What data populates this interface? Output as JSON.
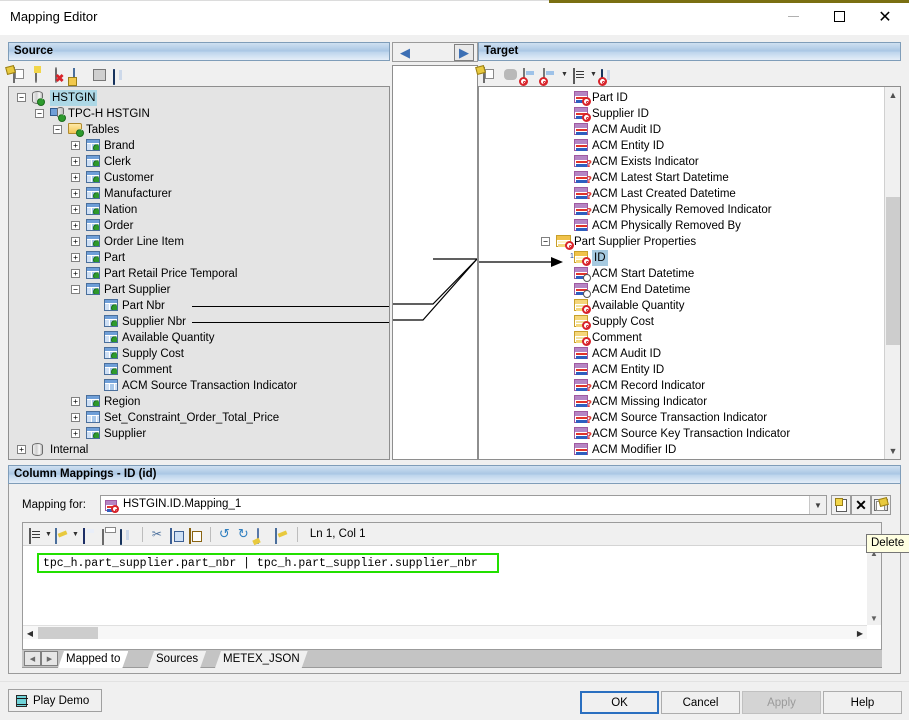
{
  "window": {
    "title": "Mapping Editor",
    "minimize_label": "—",
    "maximize_label": "□",
    "close_label": "✕",
    "accent_color": "#7a6f12"
  },
  "source_panel": {
    "header": "Source",
    "toolbar": [
      {
        "name": "open-mapping-icon",
        "tip": "Open Mapping"
      },
      {
        "name": "add-database-icon",
        "tip": "Add Database"
      },
      {
        "name": "remove-database-icon",
        "tip": "Remove Database"
      },
      {
        "name": "add-object-icon",
        "tip": "Add Object"
      },
      {
        "name": "properties-icon",
        "tip": "Properties"
      },
      {
        "name": "find-icon",
        "tip": "Find"
      }
    ],
    "tree": [
      {
        "label": "HSTGIN",
        "depth": 0,
        "expander": "-",
        "icon": "database-icon",
        "selected": true
      },
      {
        "label": "TPC-H HSTGIN",
        "depth": 1,
        "expander": "-",
        "icon": "schema-icon"
      },
      {
        "label": "Tables",
        "depth": 2,
        "expander": "-",
        "icon": "folder-icon"
      },
      {
        "label": "Brand",
        "depth": 3,
        "expander": "+",
        "icon": "table-icon"
      },
      {
        "label": "Clerk",
        "depth": 3,
        "expander": "+",
        "icon": "table-icon"
      },
      {
        "label": "Customer",
        "depth": 3,
        "expander": "+",
        "icon": "table-icon"
      },
      {
        "label": "Manufacturer",
        "depth": 3,
        "expander": "+",
        "icon": "table-icon"
      },
      {
        "label": "Nation",
        "depth": 3,
        "expander": "+",
        "icon": "table-icon"
      },
      {
        "label": "Order",
        "depth": 3,
        "expander": "+",
        "icon": "table-icon"
      },
      {
        "label": "Order Line Item",
        "depth": 3,
        "expander": "+",
        "icon": "table-icon"
      },
      {
        "label": "Part",
        "depth": 3,
        "expander": "+",
        "icon": "table-icon"
      },
      {
        "label": "Part Retail Price Temporal",
        "depth": 3,
        "expander": "+",
        "icon": "table-icon"
      },
      {
        "label": "Part Supplier",
        "depth": 3,
        "expander": "-",
        "icon": "table-icon"
      },
      {
        "label": "Part Nbr",
        "depth": 4,
        "expander": "",
        "icon": "column-icon",
        "linked": true
      },
      {
        "label": "Supplier Nbr",
        "depth": 4,
        "expander": "",
        "icon": "column-icon",
        "linked": true
      },
      {
        "label": "Available Quantity",
        "depth": 4,
        "expander": "",
        "icon": "column-icon"
      },
      {
        "label": "Supply Cost",
        "depth": 4,
        "expander": "",
        "icon": "column-icon"
      },
      {
        "label": "Comment",
        "depth": 4,
        "expander": "",
        "icon": "column-icon"
      },
      {
        "label": "ACM Source Transaction Indicator",
        "depth": 4,
        "expander": "",
        "icon": "column-plain-icon"
      },
      {
        "label": "Region",
        "depth": 3,
        "expander": "+",
        "icon": "table-icon"
      },
      {
        "label": "Set_Constraint_Order_Total_Price",
        "depth": 3,
        "expander": "+",
        "icon": "table-plain-icon"
      },
      {
        "label": "Supplier",
        "depth": 3,
        "expander": "+",
        "icon": "table-icon"
      },
      {
        "label": "Internal",
        "depth": 0,
        "expander": "+",
        "icon": "database-plain-icon"
      }
    ]
  },
  "middle_panel": {
    "nav_left_label": "◀",
    "nav_right_label": "▶"
  },
  "target_panel": {
    "header": "Target",
    "toolbar": [
      {
        "name": "open-target-icon",
        "tip": "Open Target"
      },
      {
        "name": "group-icon",
        "tip": "Group"
      },
      {
        "name": "auto-map-icon",
        "tip": "Auto Map"
      },
      {
        "name": "auto-map-options-icon",
        "tip": "Auto Map Options"
      },
      {
        "name": "filter-icon",
        "tip": "Filter"
      },
      {
        "name": "find-target-icon",
        "tip": "Find"
      }
    ],
    "tree": [
      {
        "label": "Part ID",
        "depth": 4,
        "expander": "",
        "icon": "attribute-key-icon"
      },
      {
        "label": "Supplier ID",
        "depth": 4,
        "expander": "",
        "icon": "attribute-key-icon"
      },
      {
        "label": "ACM Audit ID",
        "depth": 4,
        "expander": "",
        "icon": "attribute-icon"
      },
      {
        "label": "ACM Entity ID",
        "depth": 4,
        "expander": "",
        "icon": "attribute-icon"
      },
      {
        "label": "ACM Exists Indicator",
        "depth": 4,
        "expander": "",
        "icon": "attribute-optional-icon"
      },
      {
        "label": "ACM Latest Start Datetime",
        "depth": 4,
        "expander": "",
        "icon": "attribute-optional-icon"
      },
      {
        "label": "ACM Last Created Datetime",
        "depth": 4,
        "expander": "",
        "icon": "attribute-optional-icon"
      },
      {
        "label": "ACM Physically Removed Indicator",
        "depth": 4,
        "expander": "",
        "icon": "attribute-optional-icon"
      },
      {
        "label": "ACM Physically Removed By",
        "depth": 4,
        "expander": "",
        "icon": "attribute-icon"
      },
      {
        "label": "Part Supplier Properties",
        "depth": 3,
        "expander": "-",
        "icon": "entity-key-icon"
      },
      {
        "label": "ID",
        "depth": 4,
        "expander": "",
        "icon": "mapped-key-icon",
        "selected": true,
        "mapped_count": "1"
      },
      {
        "label": "ACM Start Datetime",
        "depth": 4,
        "expander": "",
        "icon": "attribute-clock-icon"
      },
      {
        "label": "ACM End Datetime",
        "depth": 4,
        "expander": "",
        "icon": "attribute-clock-icon"
      },
      {
        "label": "Available Quantity",
        "depth": 4,
        "expander": "",
        "icon": "attribute-yellow-key-icon"
      },
      {
        "label": "Supply Cost",
        "depth": 4,
        "expander": "",
        "icon": "attribute-yellow-key-icon"
      },
      {
        "label": "Comment",
        "depth": 4,
        "expander": "",
        "icon": "attribute-yellow-key-icon"
      },
      {
        "label": "ACM Audit ID",
        "depth": 4,
        "expander": "",
        "icon": "attribute-icon"
      },
      {
        "label": "ACM Entity ID",
        "depth": 4,
        "expander": "",
        "icon": "attribute-icon"
      },
      {
        "label": "ACM Record Indicator",
        "depth": 4,
        "expander": "",
        "icon": "attribute-optional-icon"
      },
      {
        "label": "ACM Missing Indicator",
        "depth": 4,
        "expander": "",
        "icon": "attribute-optional-icon"
      },
      {
        "label": "ACM Source Transaction Indicator",
        "depth": 4,
        "expander": "",
        "icon": "attribute-optional-icon"
      },
      {
        "label": "ACM Source Key Transaction Indicator",
        "depth": 4,
        "expander": "",
        "icon": "attribute-optional-icon"
      },
      {
        "label": "ACM Modifier ID",
        "depth": 4,
        "expander": "",
        "icon": "attribute-icon"
      }
    ],
    "scroll_up_label": "▲",
    "scroll_down_label": "▼"
  },
  "column_mappings": {
    "header": "Column Mappings - ID (id)",
    "mapping_for_label": "Mapping for:",
    "mapping_value": "HSTGIN.ID.Mapping_1",
    "dropdown_caret": "▼",
    "buttons": [
      {
        "name": "new-mapping-button",
        "label": "new"
      },
      {
        "name": "delete-mapping-button",
        "label": "✕"
      },
      {
        "name": "edit-mapping-button",
        "label": "edit"
      }
    ],
    "tooltip": "Delete",
    "editor_toolbar": [
      {
        "name": "template-menu-icon"
      },
      {
        "name": "edit-menu-icon"
      },
      {
        "name": "save-icon"
      },
      {
        "name": "print-icon"
      },
      {
        "name": "find-replace-icon"
      },
      {
        "name": "cut-icon"
      },
      {
        "name": "copy-icon"
      },
      {
        "name": "paste-icon"
      },
      {
        "name": "undo-icon"
      },
      {
        "name": "redo-icon"
      },
      {
        "name": "user-function-icon"
      },
      {
        "name": "expression-edit-icon"
      }
    ],
    "caret_position": "Ln 1, Col 1",
    "code": "tpc_h.part_supplier.part_nbr | tpc_h.part_supplier.supplier_nbr",
    "code_highlight_color": "#22e000",
    "tabs": [
      {
        "label": "Mapped to",
        "active": true
      },
      {
        "label": "Sources",
        "active": false
      },
      {
        "label": "METEX_JSON",
        "active": false
      }
    ],
    "tab_prev_label": "◀",
    "tab_next_label": "▶",
    "hscroll_left_label": "◀",
    "hscroll_right_label": "▶"
  },
  "footer": {
    "play_demo": "Play Demo",
    "ok": "OK",
    "cancel": "Cancel",
    "apply": "Apply",
    "help": "Help",
    "apply_disabled": true
  }
}
